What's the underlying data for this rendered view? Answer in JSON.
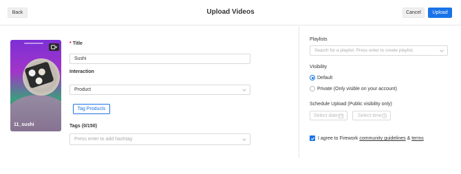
{
  "header": {
    "back_label": "Back",
    "title": "Upload Videos",
    "cancel_label": "Cancel",
    "upload_label": "Upload"
  },
  "video": {
    "name": "11_sushi"
  },
  "form": {
    "title_label": "Title",
    "title_required_mark": "*",
    "title_value": "Sushi",
    "interaction_label": "Interaction",
    "interaction_value": "Product",
    "tag_products_label": "Tag Products",
    "tags_label": "Tags (0/150)",
    "tags_placeholder": "Press enter to add hashtag"
  },
  "settings": {
    "playlists_label": "Playlists",
    "playlists_placeholder": "Search for a playlist. Press enter to create playlist.",
    "visibility_label": "Visibility",
    "visibility_options": [
      {
        "label": "Default",
        "selected": true
      },
      {
        "label": "Private (Only visible on your account)",
        "selected": false
      }
    ],
    "schedule_label": "Schedule Upload (Public visibility only)",
    "select_date_placeholder": "Select date",
    "select_time_placeholder": "Select time",
    "agree_prefix": "I agree to Firework",
    "agree_link1": "community guidelines",
    "agree_and": "&",
    "agree_link2": "terms",
    "agree_checked": true
  },
  "colors": {
    "accent": "#1a73e8",
    "required": "#ee0033"
  }
}
